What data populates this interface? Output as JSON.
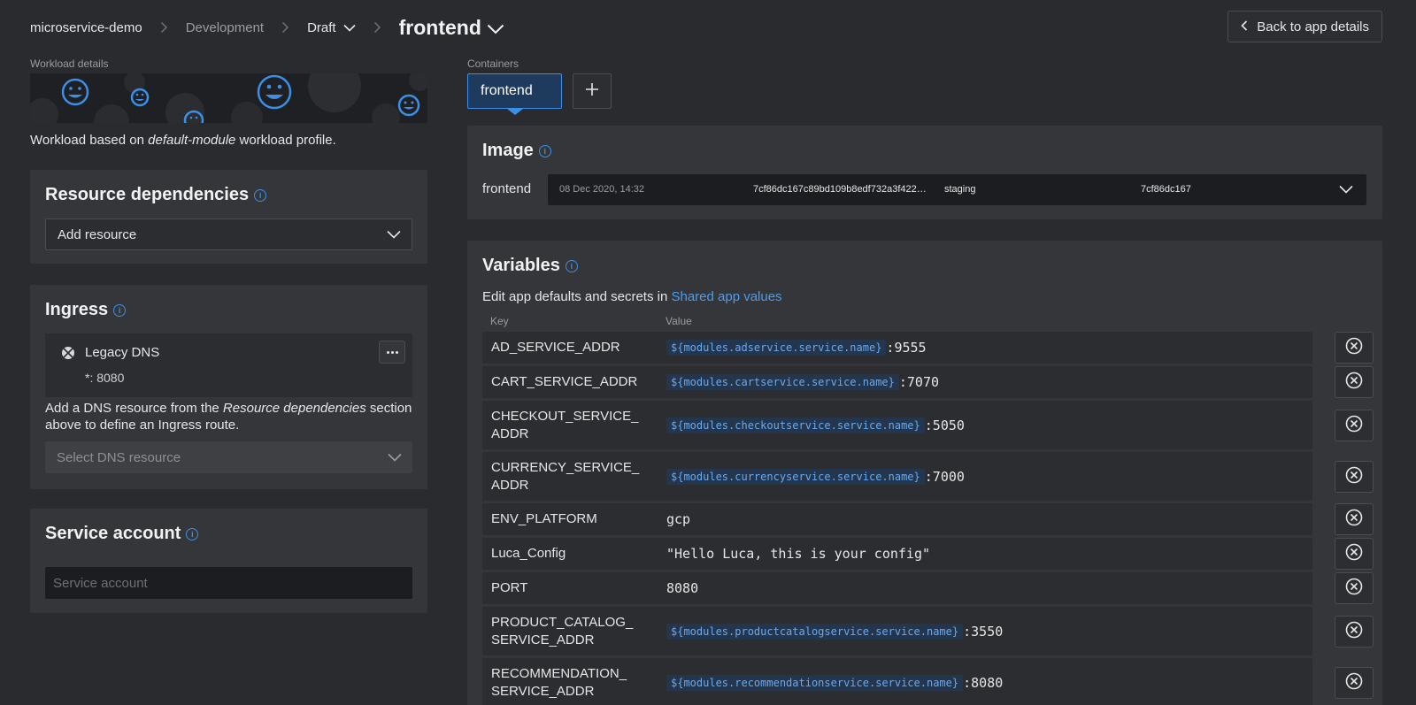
{
  "breadcrumb": {
    "app": "microservice-demo",
    "environment": "Development",
    "state": "Draft",
    "workload": "frontend"
  },
  "header": {
    "back_label": "Back to app details"
  },
  "left": {
    "section_label": "Workload details",
    "profile_prefix": "Workload based on ",
    "profile_name": "default-module",
    "profile_suffix": " workload profile.",
    "resource_deps": {
      "title": "Resource dependencies",
      "select_value": "Add resource"
    },
    "ingress": {
      "title": "Ingress",
      "dns_name": "Legacy DNS",
      "dns_port": "*: 8080",
      "hint_prefix": "Add a DNS resource from the ",
      "hint_emphasis": "Resource dependencies",
      "hint_suffix": " section above to define an Ingress route.",
      "select_placeholder": "Select DNS resource"
    },
    "service_account": {
      "title": "Service account",
      "placeholder": "Service account"
    }
  },
  "right": {
    "section_label": "Containers",
    "tabs": [
      {
        "label": "frontend"
      }
    ],
    "image": {
      "title": "Image",
      "container": "frontend",
      "date": "08 Dec 2020, 14:32",
      "digest": "7cf86dc167c89bd109b8edf732a3f422…",
      "branch": "staging",
      "commit": "7cf86dc167"
    },
    "variables": {
      "title": "Variables",
      "intro": "Edit app defaults and secrets in ",
      "link": "Shared app values",
      "col_key": "Key",
      "col_value": "Value",
      "rows": [
        {
          "key": "AD_SERVICE_ADDR",
          "ref": "${modules.adservice.service.name}",
          "suffix": ":9555"
        },
        {
          "key": "CART_SERVICE_ADDR",
          "ref": "${modules.cartservice.service.name}",
          "suffix": ":7070"
        },
        {
          "key1": "CHECKOUT_SERVICE_",
          "key2": "ADDR",
          "ref": "${modules.checkoutservice.service.name}",
          "suffix": ":5050"
        },
        {
          "key1": "CURRENCY_SERVICE_",
          "key2": "ADDR",
          "ref": "${modules.currencyservice.service.name}",
          "suffix": ":7000"
        },
        {
          "key": "ENV_PLATFORM",
          "value": "gcp"
        },
        {
          "key": "Luca_Config",
          "value": "\"Hello Luca, this is your config\""
        },
        {
          "key": "PORT",
          "value": "8080"
        },
        {
          "key1": "PRODUCT_CATALOG_",
          "key2": "SERVICE_ADDR",
          "ref": "${modules.productcatalogservice.service.name}",
          "suffix": ":3550"
        },
        {
          "key1": "RECOMMENDATION_",
          "key2": "SERVICE_ADDR",
          "ref": "${modules.recommendationservice.service.name}",
          "suffix": ":8080"
        }
      ]
    }
  },
  "colors": {
    "accent": "#3b8fe6",
    "background": "#2a2b2e",
    "card": "#35363a"
  }
}
